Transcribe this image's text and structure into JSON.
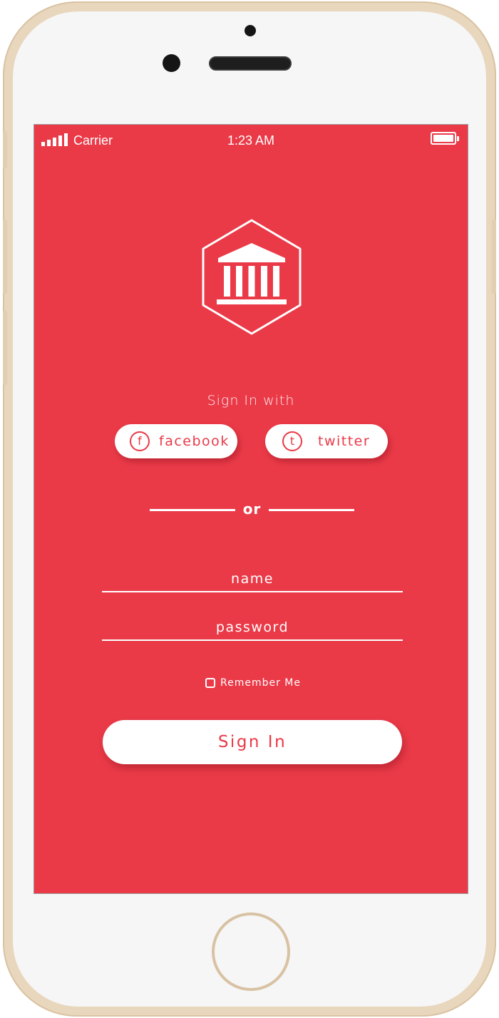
{
  "status_bar": {
    "carrier": "Carrier",
    "time": "1:23 AM",
    "battery_level": 1.0,
    "signal_bars": 5
  },
  "logo": {
    "icon": "bank-building-icon"
  },
  "social": {
    "heading": "Sign In with",
    "facebook": {
      "icon": "facebook-icon",
      "label": "facebook"
    },
    "twitter": {
      "icon": "twitter-icon",
      "label": "twitter"
    }
  },
  "divider": {
    "label": "or"
  },
  "form": {
    "name_placeholder": "name",
    "password_placeholder": "password",
    "remember_label": "Remember Me",
    "remember_checked": false,
    "submit_label": "Sign In"
  },
  "colors": {
    "accent": "#ea3a48",
    "foreground": "#ffffff",
    "frame": "#e8d6bd"
  }
}
